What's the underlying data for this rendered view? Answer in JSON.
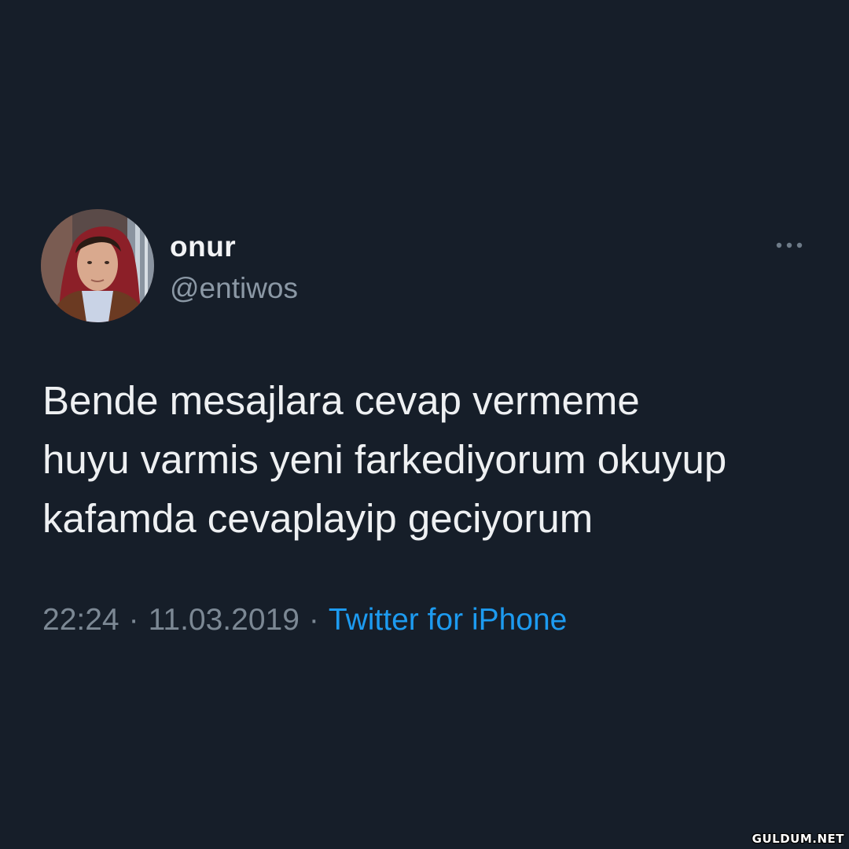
{
  "tweet": {
    "author": {
      "name": "onur",
      "handle": "@entiwos",
      "avatar_icon": "profile-photo"
    },
    "more_icon": "more-horizontal-icon",
    "text": "Bende mesajlara cevap vermeme\nhuyu varmis yeni farkediyorum okuyup\nkafamda cevaplayip geciyorum",
    "time": "22:24",
    "separator": "·",
    "date": "11.03.2019",
    "source": "Twitter for iPhone"
  },
  "watermark": "GULDUM.NET",
  "colors": {
    "background": "#161e29",
    "text_primary": "#eef0f2",
    "text_secondary": "#7c8894",
    "link": "#1d9bf0"
  }
}
